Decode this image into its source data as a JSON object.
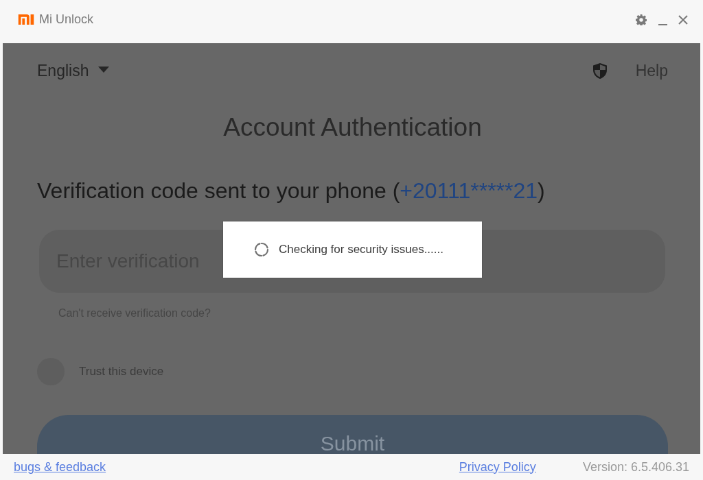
{
  "window": {
    "title": "Mi Unlock"
  },
  "header": {
    "language": "English",
    "help": "Help"
  },
  "title": "Account Authentication",
  "prompt": {
    "text": "Verification code sent to your phone (",
    "phone": "+20111*****21",
    "suffix": ")"
  },
  "code_field": {
    "placeholder": "Enter verification"
  },
  "help_link": "Can't receive verification code?",
  "trust_device": {
    "label": "Trust this device",
    "checked": false
  },
  "submit": {
    "label": "Submit"
  },
  "dialog": {
    "message": "Checking for security issues......"
  },
  "footer": {
    "feedback_link": "bugs & feedback",
    "privacy_link": "Privacy Policy",
    "version": "Version: 6.5.406.31"
  }
}
